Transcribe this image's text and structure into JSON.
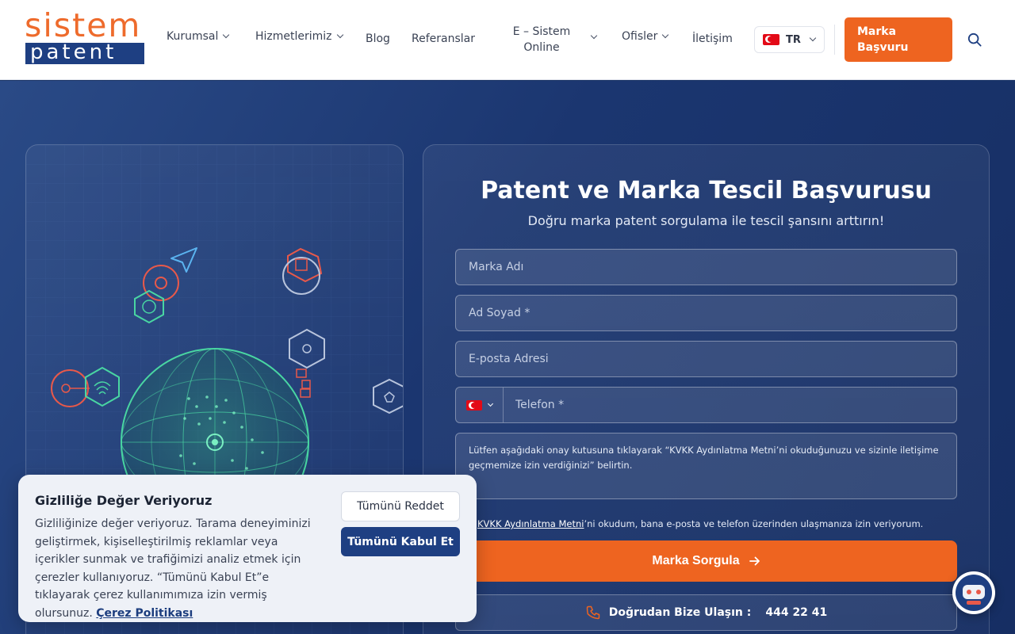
{
  "brand": {
    "logo_top": "sistem",
    "logo_bottom": "patent"
  },
  "nav": {
    "kurumsal": "Kurumsal",
    "hizmetlerimiz": "Hizmetlerimiz",
    "blog": "Blog",
    "referanslar": "Referanslar",
    "esistem_line1": "E – Sistem",
    "esistem_line2": "Online",
    "ofisler": "Ofisler",
    "iletisim": "İletişim",
    "lang": "TR",
    "cta_line1": "Marka",
    "cta_line2": "Başvuru"
  },
  "form": {
    "title": "Patent ve Marka Tescil Başvurusu",
    "subtitle": "Doğru marka patent sorgulama ile tescil şansını arttırın!",
    "brand_placeholder": "Marka Adı",
    "name_placeholder": "Ad Soyad *",
    "email_placeholder": "E-posta Adresi",
    "phone_placeholder": "Telefon *",
    "notice": "Lütfen aşağıdaki onay kutusuna tıklayarak “KVKK Aydınlatma Metni’ni okuduğunuzu ve sizinle iletişime geçmemize izin verdiğinizi” belirtin.",
    "consent_link": "KVKK Aydınlatma Metni",
    "consent_text": "’ni okudum, bana e-posta ve telefon üzerinden ulaşmanıza izin veriyorum.",
    "submit": "Marka Sorgula",
    "contact_label": "Doğrudan Bize Ulaşın :",
    "contact_number": "444 22 41"
  },
  "cookie": {
    "title": "Gizliliğe Değer Veriyoruz",
    "text": "Gizliliğinize değer veriyoruz. Tarama deneyiminizi geliştirmek, kişiselleştirilmiş reklamlar veya içerikler sunmak ve trafiğimizi analiz etmek için çerezler kullanıyoruz. “Tümünü Kabul Et”e tıklayarak çerez kullanımımıza izin vermiş olursunuz.",
    "policy_link": "Çerez Politikası",
    "reject": "Tümünü Reddet",
    "accept": "Tümünü Kabul Et"
  },
  "colors": {
    "accent": "#ee6420",
    "navy": "#1e3f82",
    "globe": "#49d6a2",
    "icon_red": "#e8594a"
  }
}
